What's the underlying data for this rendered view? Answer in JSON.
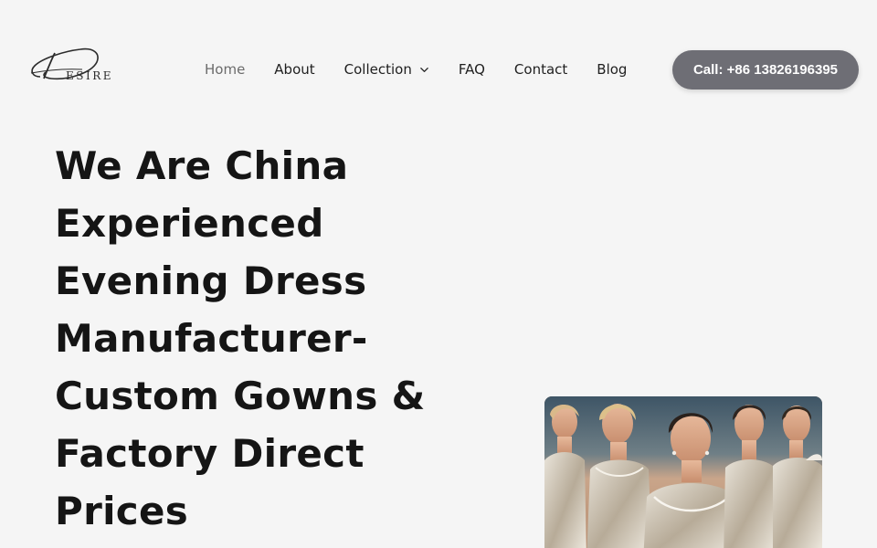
{
  "header": {
    "logo_alt": "Desire logo",
    "logo_text": "DESIRE",
    "nav": [
      {
        "label": "Home",
        "active": true
      },
      {
        "label": "About"
      },
      {
        "label": "Collection",
        "has_dropdown": true
      },
      {
        "label": "FAQ"
      },
      {
        "label": "Contact"
      },
      {
        "label": "Blog"
      }
    ],
    "call_button": "Call: +86 13826196395"
  },
  "hero": {
    "heading_lines": [
      "We Are China",
      "Experienced",
      "Evening Dress",
      "Manufacturer-",
      "Custom Gowns &",
      "Factory Direct",
      "Prices"
    ],
    "image_alt": "Models wearing sequined evening gowns"
  },
  "colors": {
    "background": "#f5f5f5",
    "button_bg": "#6e6e75",
    "button_text": "#ffffff",
    "heading": "#151515",
    "nav_active": "#6b6b6b"
  },
  "icons": {
    "dropdown": "chevron-down-icon"
  }
}
